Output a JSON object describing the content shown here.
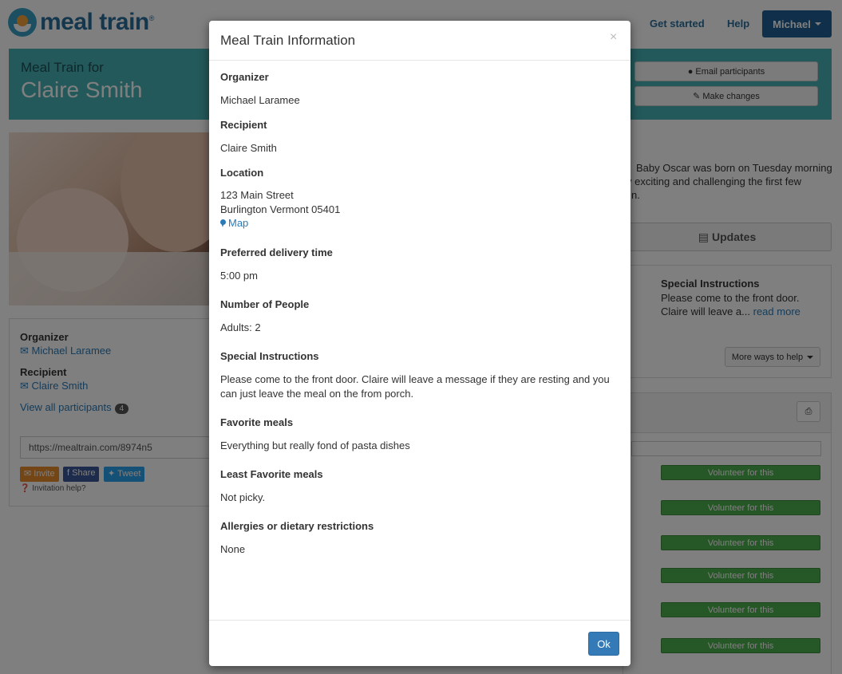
{
  "nav": {
    "logo_text": "meal train",
    "links": [
      "Get started",
      "Help"
    ],
    "user_label": "Michael"
  },
  "banner": {
    "subtitle": "Meal Train for",
    "name": "Claire Smith",
    "email_btn": "Email participants",
    "changes_btn": "Make changes"
  },
  "sidebar": {
    "organizer_label": "Organizer",
    "organizer_name": "Michael Laramee",
    "recipient_label": "Recipient",
    "recipient_name": "Claire Smith",
    "participants_link": "View all participants",
    "participants_count": "4",
    "url": "https://mealtrain.com/8974n5",
    "invite": "Invite",
    "share": "Share",
    "tweet": "Tweet",
    "help": "Invitation help?"
  },
  "story": {
    "text": "Baby Oscar was born on Tuesday morning",
    "text2": "v exciting and challenging the first few",
    "text3": "n."
  },
  "updates_tab": "Updates",
  "special": {
    "title": "Special Instructions",
    "text": "Please come to the front door. Claire will leave a...",
    "read_more": "read more",
    "more_ways": "More ways to help"
  },
  "calendar": {
    "volunteer_label": "Volunteer for this"
  },
  "modal": {
    "title": "Meal Train Information",
    "close": "×",
    "fields": {
      "organizer_label": "Organizer",
      "organizer_value": "Michael Laramee",
      "recipient_label": "Recipient",
      "recipient_value": "Claire Smith",
      "location_label": "Location",
      "address_line1": "123 Main Street",
      "address_line2": "Burlington Vermont 05401",
      "map_link": "Map",
      "delivery_label": "Preferred delivery time",
      "delivery_value": "5:00 pm",
      "people_label": "Number of People",
      "people_value": "Adults: 2",
      "instructions_label": "Special Instructions",
      "instructions_value": "Please come to the front door.  Claire will leave a message if they are resting and you can just leave the meal on the from porch.",
      "favorite_label": "Favorite meals",
      "favorite_value": "Everything but really fond of pasta dishes",
      "least_label": "Least Favorite meals",
      "least_value": "Not picky.",
      "allergies_label": "Allergies or dietary restrictions",
      "allergies_value": "None"
    },
    "ok_label": "Ok"
  }
}
